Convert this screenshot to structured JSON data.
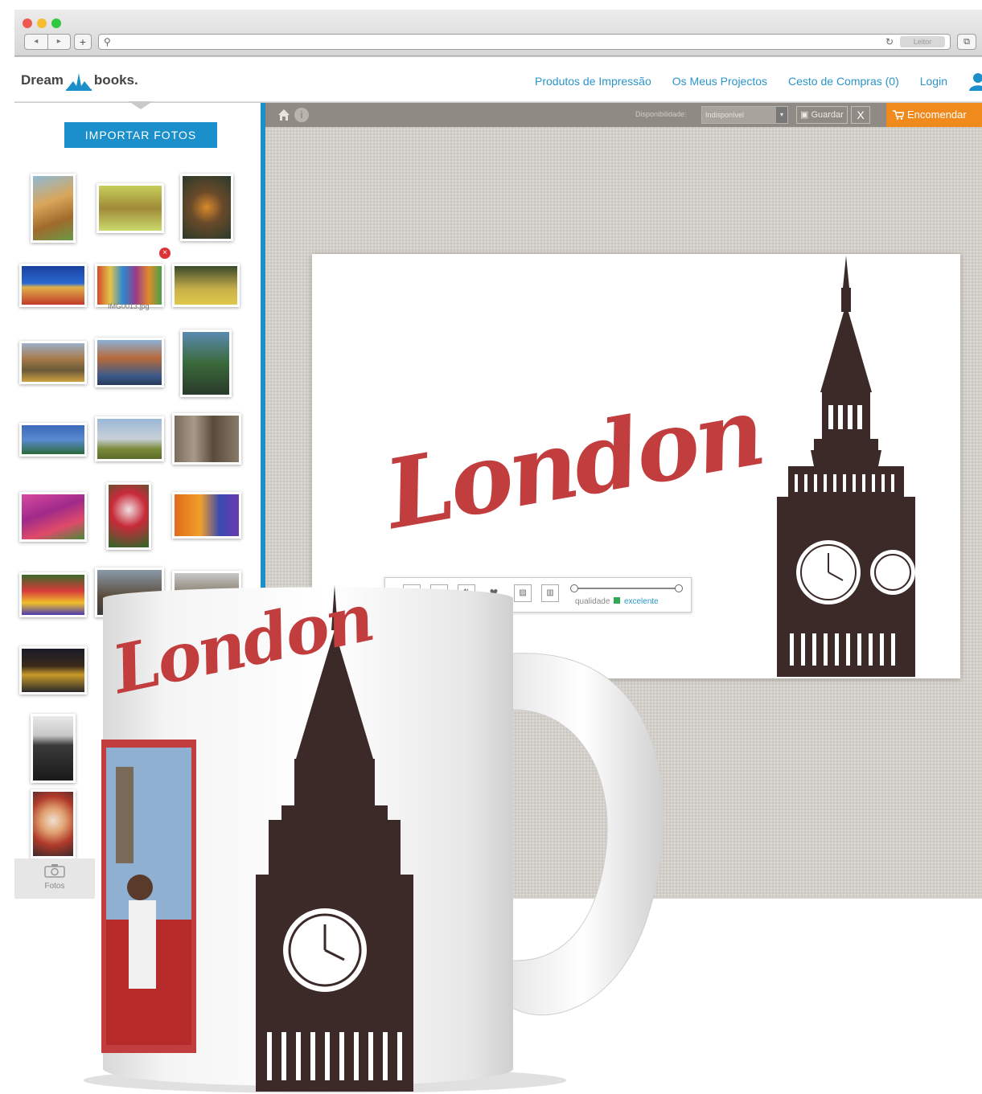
{
  "browser": {
    "nav_back": "◂",
    "nav_forward": "▸",
    "new_tab": "+",
    "search_glyph": "⚲",
    "reload_glyph": "↻",
    "reader_label": "Leitor",
    "share_glyph": "⧉"
  },
  "site": {
    "logo_left": "Dream",
    "logo_right": "books.",
    "nav": [
      {
        "label": "Produtos de Impressão"
      },
      {
        "label": "Os Meus Projectos"
      },
      {
        "label": "Cesto de Compras (0)"
      },
      {
        "label": "Login"
      }
    ]
  },
  "sidebar": {
    "import_label": "IMPORTAR FOTOS",
    "thumb_caption": "IMG0013.jpg",
    "delete_glyph": "×",
    "fotos_tab_label": "Fotos"
  },
  "toolbar": {
    "info_glyph": "i",
    "availability_label": "Disponibilidade:",
    "availability_value": "Indisponível",
    "dropdown_glyph": "▾",
    "save_label": "Guardar",
    "close_glyph": "X",
    "order_label": "Encomendar"
  },
  "design": {
    "title_text": "London"
  },
  "image_tools": {
    "resolution_label": "qualidade",
    "resolution_value": "excelente"
  },
  "mug": {
    "title_text": "London"
  },
  "colors": {
    "accent_blue": "#1a8fc9",
    "order_orange": "#f08a1c",
    "london_red": "#c23d3d",
    "tower_brown": "#3b2a28"
  }
}
